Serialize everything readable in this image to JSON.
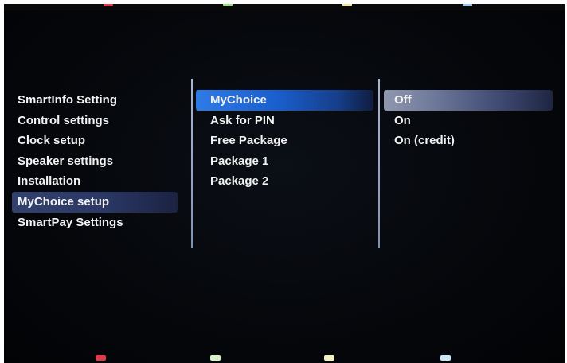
{
  "sidebar": {
    "items": [
      {
        "label": "SmartInfo Setting"
      },
      {
        "label": "Control settings"
      },
      {
        "label": "Clock setup"
      },
      {
        "label": "Speaker settings"
      },
      {
        "label": "Installation"
      },
      {
        "label": "MyChoice setup",
        "selected": true
      },
      {
        "label": "SmartPay Settings"
      }
    ]
  },
  "submenu": {
    "items": [
      {
        "label": "MyChoice",
        "focused": true
      },
      {
        "label": "Ask for PIN"
      },
      {
        "label": "Free Package"
      },
      {
        "label": "Package 1"
      },
      {
        "label": "Package 2"
      }
    ]
  },
  "options": {
    "items": [
      {
        "label": "Off",
        "selected": true
      },
      {
        "label": "On"
      },
      {
        "label": "On (credit)"
      }
    ]
  },
  "color_keys": [
    {
      "name": "red-key",
      "color": "#e23a48"
    },
    {
      "name": "green-key",
      "color": "#d8f2c8"
    },
    {
      "name": "yellow-key",
      "color": "#f5f0c0"
    },
    {
      "name": "blue-key",
      "color": "#cfe6f7"
    }
  ],
  "top_indicators": [
    {
      "color": "#e23a48"
    },
    {
      "color": "#9fdc8a"
    },
    {
      "color": "#efe6a8"
    },
    {
      "color": "#9cc8ee"
    }
  ]
}
